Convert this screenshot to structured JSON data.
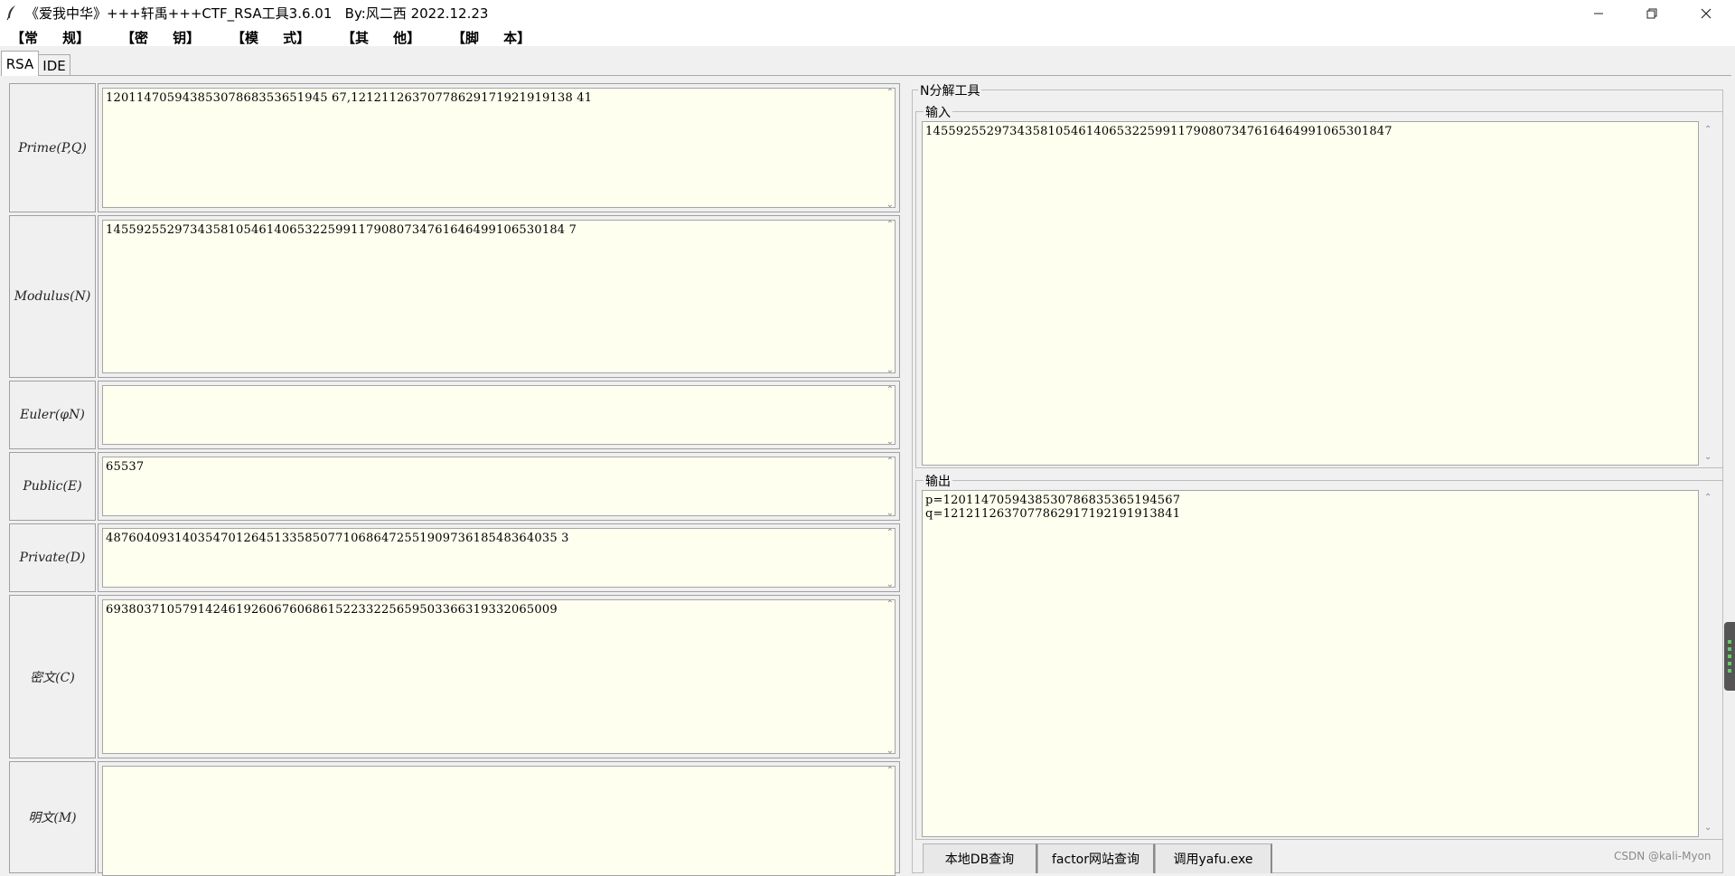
{
  "window": {
    "title": "《爱我中华》+++轩禹+++CTF_RSA工具3.6.01   By:风二西 2022.12.23",
    "minimize_icon": "minimize-icon",
    "maximize_icon": "restore-icon",
    "close_icon": "close-icon"
  },
  "menu": [
    "【常   规】",
    "【密   钥】",
    "【模   式】",
    "【其   他】",
    "【脚   本】"
  ],
  "tabs": {
    "rsa": "RSA",
    "ide": "IDE"
  },
  "rsa": {
    "rows": [
      {
        "label": "Prime(P,Q)",
        "value": "12011470594385307868353651945 67,12121126370778629171921919138 41"
      },
      {
        "label": "Modulus(N)",
        "value": "145592552973435810546140653225991179080734761646499106530184 7"
      },
      {
        "label": "Euler(φN)",
        "value": ""
      },
      {
        "label": "Public(E)",
        "value": "65537"
      },
      {
        "label": "Private(D)",
        "value": "48760409314035470126451335850771068647255190973618548364035 3"
      },
      {
        "label": "密文(C)",
        "value": "69380371057914246192606760686152233225659503366319332065009"
      },
      {
        "label": "明文(M)",
        "value": ""
      }
    ]
  },
  "factor": {
    "title": "N分解工具",
    "input_title": "输入",
    "input_value": "1455925529734358105461406532259911790807347616464991065301847",
    "output_title": "输出",
    "output_lines": [
      "p=1201147059438530786835365194567",
      "q=1212112637077862917192191913841"
    ],
    "buttons": [
      "本地DB查询",
      "factor网站查询",
      "调用yafu.exe"
    ]
  },
  "watermark": "CSDN @kali-Myon"
}
